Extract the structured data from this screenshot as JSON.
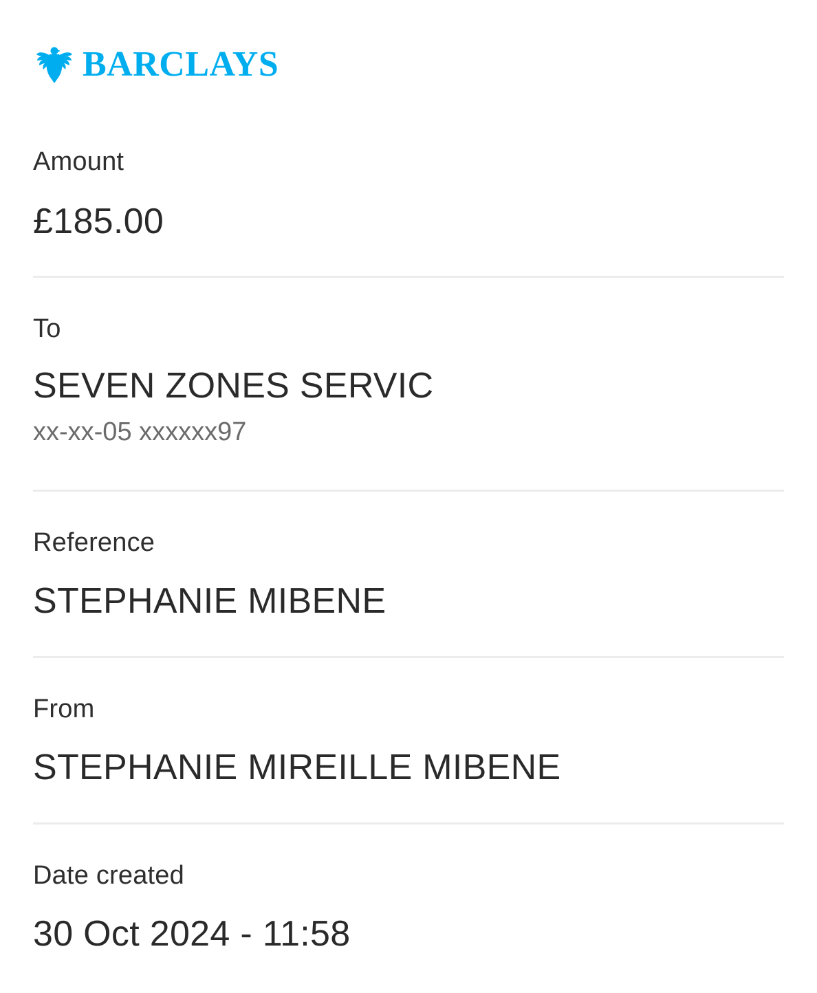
{
  "brand": {
    "name": "BARCLAYS",
    "logo_icon": "eagle-icon",
    "color": "#00AEEF"
  },
  "amount": {
    "label": "Amount",
    "value": "£185.00"
  },
  "to": {
    "label": "To",
    "value": "SEVEN ZONES SERVIC",
    "account": "xx-xx-05 xxxxxx97"
  },
  "reference": {
    "label": "Reference",
    "value": "STEPHANIE MIBENE"
  },
  "from": {
    "label": "From",
    "value": "STEPHANIE MIREILLE MIBENE"
  },
  "date_created": {
    "label": "Date created",
    "value": "30 Oct 2024 - 11:58"
  },
  "colors": {
    "text": "#2a2a2a",
    "muted": "#6b6b6b",
    "divider": "#ececec"
  }
}
